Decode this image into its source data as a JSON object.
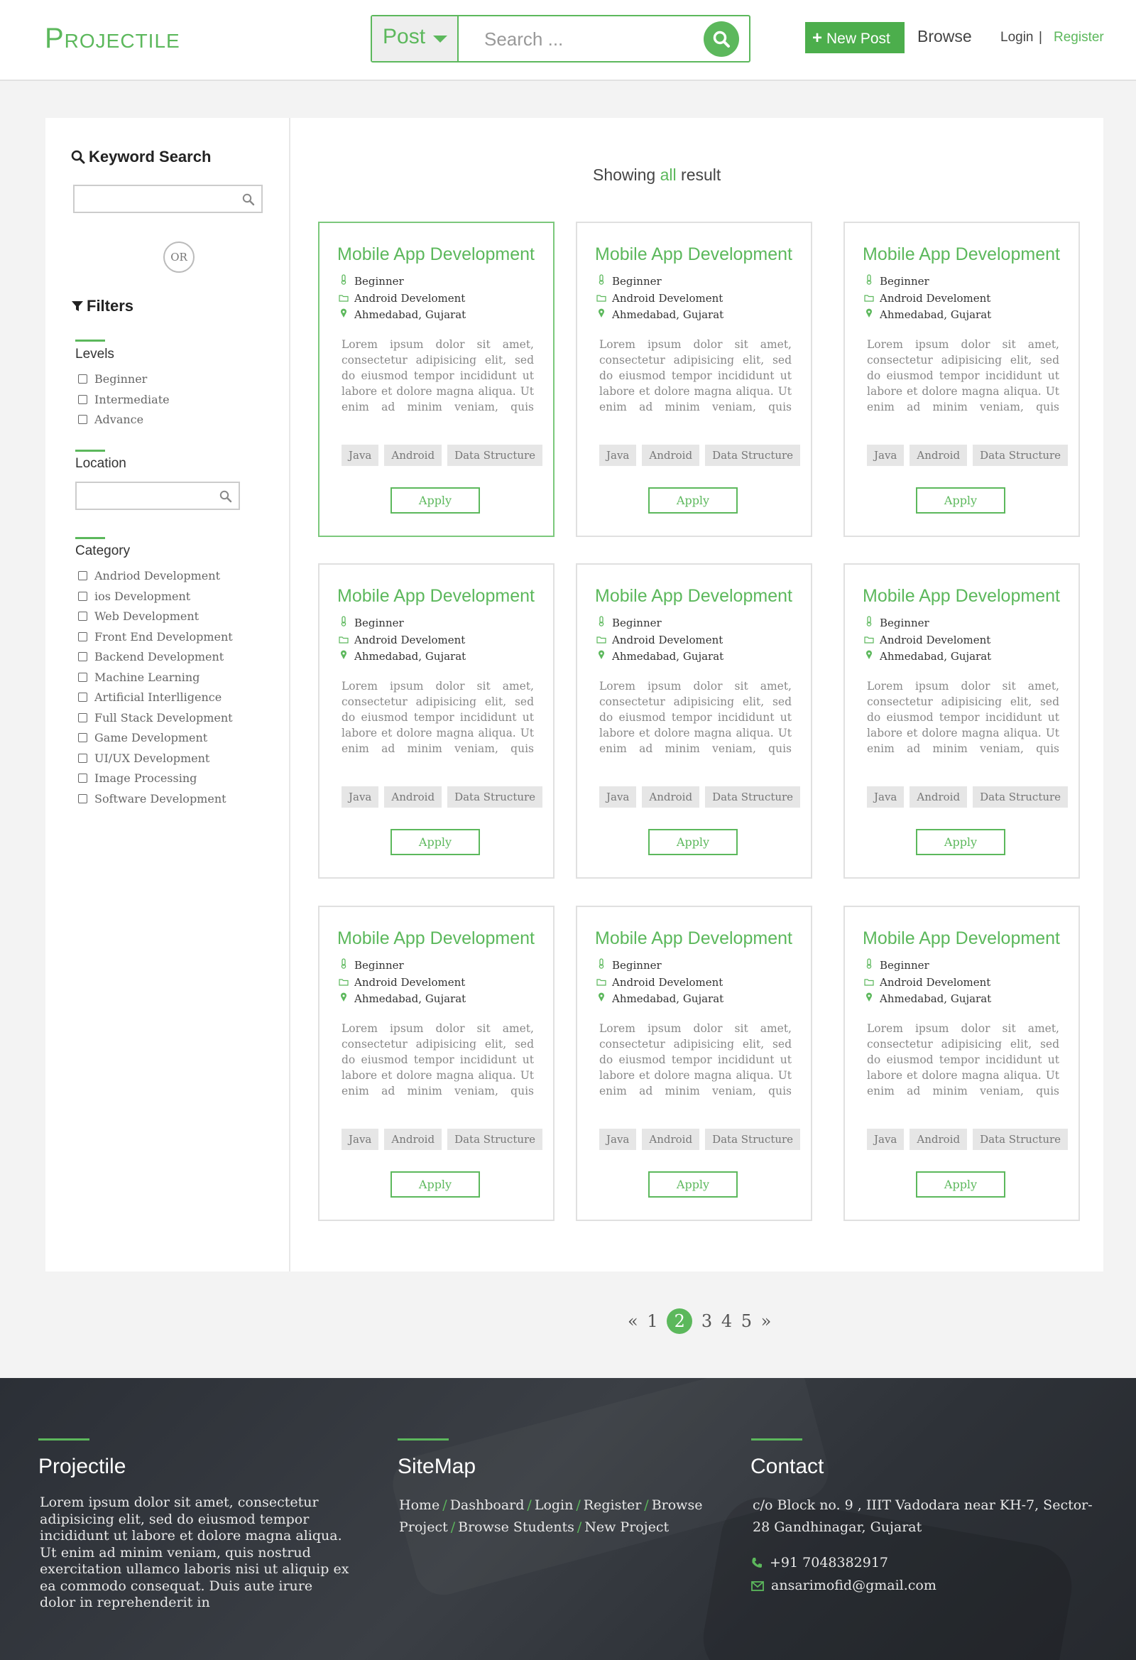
{
  "header": {
    "logo": "Projectile",
    "post_select": "Post",
    "search_placeholder": "Search ...",
    "new_post": "New Post",
    "browse": "Browse",
    "login": "Login",
    "separator": "|",
    "register": "Register"
  },
  "sidebar": {
    "keyword_title": "Keyword Search",
    "or": "OR",
    "filters_title": "Filters",
    "levels_title": "Levels",
    "levels": [
      "Beginner",
      "Intermediate",
      "Advance"
    ],
    "location_title": "Location",
    "category_title": "Category",
    "categories": [
      "Andriod Development",
      "ios Development",
      "Web Development",
      "Front End Development",
      "Backend Development",
      "Machine Learning",
      "Artificial Interlligence",
      "Full Stack Development",
      "Game Development",
      "UI/UX Development",
      "Image Processing",
      "Software Development"
    ]
  },
  "results": {
    "showing_prefix": "Showing",
    "showing_highlight": "all",
    "showing_suffix": "result"
  },
  "cards": [
    {
      "title": "Mobile App Development",
      "level": "Beginner",
      "category": "Android Develoment",
      "location": "Ahmedabad, Gujarat",
      "description": "Lorem ipsum dolor sit amet, consectetur adipisicing elit, sed do eiusmod tempor incididunt ut labore et dolore magna aliqua. Ut enim ad minim veniam, quis nostrud exercitation ullamco laboris nisi ut aliquip ex ea",
      "tags": [
        "Java",
        "Android",
        "Data Structure"
      ],
      "apply": "Apply"
    },
    {
      "title": "Mobile App Development",
      "level": "Beginner",
      "category": "Android Develoment",
      "location": "Ahmedabad, Gujarat",
      "description": "Lorem ipsum dolor sit amet, consectetur adipisicing elit, sed do eiusmod tempor incididunt ut labore et dolore magna aliqua. Ut enim ad minim veniam, quis nostrud exercitation ullamco laboris nisi ut aliquip ex ea",
      "tags": [
        "Java",
        "Android",
        "Data Structure"
      ],
      "apply": "Apply"
    },
    {
      "title": "Mobile App Development",
      "level": "Beginner",
      "category": "Android Develoment",
      "location": "Ahmedabad, Gujarat",
      "description": "Lorem ipsum dolor sit amet, consectetur adipisicing elit, sed do eiusmod tempor incididunt ut labore et dolore magna aliqua. Ut enim ad minim veniam, quis nostrud exercitation ullamco laboris nisi ut aliquip ex ea",
      "tags": [
        "Java",
        "Android",
        "Data Structure"
      ],
      "apply": "Apply"
    },
    {
      "title": "Mobile App Development",
      "level": "Beginner",
      "category": "Android Develoment",
      "location": "Ahmedabad, Gujarat",
      "description": "Lorem ipsum dolor sit amet, consectetur adipisicing elit, sed do eiusmod tempor incididunt ut labore et dolore magna aliqua. Ut enim ad minim veniam, quis nostrud exercitation ullamco laboris nisi ut aliquip ex ea",
      "tags": [
        "Java",
        "Android",
        "Data Structure"
      ],
      "apply": "Apply"
    },
    {
      "title": "Mobile App Development",
      "level": "Beginner",
      "category": "Android Develoment",
      "location": "Ahmedabad, Gujarat",
      "description": "Lorem ipsum dolor sit amet, consectetur adipisicing elit, sed do eiusmod tempor incididunt ut labore et dolore magna aliqua. Ut enim ad minim veniam, quis nostrud exercitation ullamco laboris nisi ut aliquip ex ea",
      "tags": [
        "Java",
        "Android",
        "Data Structure"
      ],
      "apply": "Apply"
    },
    {
      "title": "Mobile App Development",
      "level": "Beginner",
      "category": "Android Develoment",
      "location": "Ahmedabad, Gujarat",
      "description": "Lorem ipsum dolor sit amet, consectetur adipisicing elit, sed do eiusmod tempor incididunt ut labore et dolore magna aliqua. Ut enim ad minim veniam, quis nostrud exercitation ullamco laboris nisi ut aliquip ex ea",
      "tags": [
        "Java",
        "Android",
        "Data Structure"
      ],
      "apply": "Apply"
    },
    {
      "title": "Mobile App Development",
      "level": "Beginner",
      "category": "Android Develoment",
      "location": "Ahmedabad, Gujarat",
      "description": "Lorem ipsum dolor sit amet, consectetur adipisicing elit, sed do eiusmod tempor incididunt ut labore et dolore magna aliqua. Ut enim ad minim veniam, quis nostrud exercitation ullamco laboris nisi ut aliquip ex ea",
      "tags": [
        "Java",
        "Android",
        "Data Structure"
      ],
      "apply": "Apply"
    },
    {
      "title": "Mobile App Development",
      "level": "Beginner",
      "category": "Android Develoment",
      "location": "Ahmedabad, Gujarat",
      "description": "Lorem ipsum dolor sit amet, consectetur adipisicing elit, sed do eiusmod tempor incididunt ut labore et dolore magna aliqua. Ut enim ad minim veniam, quis nostrud exercitation ullamco laboris nisi ut aliquip ex ea",
      "tags": [
        "Java",
        "Android",
        "Data Structure"
      ],
      "apply": "Apply"
    },
    {
      "title": "Mobile App Development",
      "level": "Beginner",
      "category": "Android Develoment",
      "location": "Ahmedabad, Gujarat",
      "description": "Lorem ipsum dolor sit amet, consectetur adipisicing elit, sed do eiusmod tempor incididunt ut labore et dolore magna aliqua. Ut enim ad minim veniam, quis nostrud exercitation ullamco laboris nisi ut aliquip ex ea",
      "tags": [
        "Java",
        "Android",
        "Data Structure"
      ],
      "apply": "Apply"
    }
  ],
  "pagination": {
    "prev": "«",
    "pages": [
      "1",
      "2",
      "3",
      "4",
      "5"
    ],
    "current": "2",
    "next": "»"
  },
  "footer": {
    "about_title": "Projectile",
    "about_text": "Lorem ipsum dolor sit amet, consectetur adipisicing elit, sed do eiusmod tempor incididunt ut labore et dolore magna aliqua. Ut enim ad minim veniam, quis nostrud exercitation ullamco laboris nisi ut aliquip ex ea commodo consequat. Duis aute irure dolor in reprehenderit in",
    "sitemap_title": "SiteMap",
    "sitemap_links": [
      "Home",
      "Dashboard",
      "Login",
      "Register",
      "Browse Project",
      "Browse Students",
      "New Project"
    ],
    "sitemap_divider": "/",
    "contact_title": "Contact",
    "address": "c/o Block no. 9 , IIIT Vadodara near KH-7, Sector-28 Gandhinagar, Gujarat",
    "phone": "+91 7048382917",
    "email": "ansarimofid@gmail.com"
  },
  "colors": {
    "accent": "#5cb85c",
    "footer_bg": "#33373d",
    "page_bg": "#f3f3f3"
  }
}
